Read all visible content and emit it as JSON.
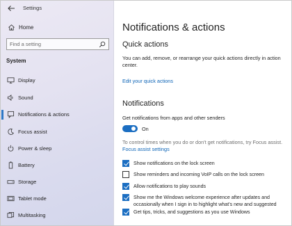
{
  "window": {
    "title": "Settings"
  },
  "sidebar": {
    "home_label": "Home",
    "search_placeholder": "Find a setting",
    "section_label": "System",
    "items": [
      {
        "label": "Display",
        "icon": "display-icon"
      },
      {
        "label": "Sound",
        "icon": "sound-icon"
      },
      {
        "label": "Notifications & actions",
        "icon": "notifications-icon",
        "active": true
      },
      {
        "label": "Focus assist",
        "icon": "moon-icon"
      },
      {
        "label": "Power & sleep",
        "icon": "power-icon"
      },
      {
        "label": "Battery",
        "icon": "battery-icon"
      },
      {
        "label": "Storage",
        "icon": "storage-icon"
      },
      {
        "label": "Tablet mode",
        "icon": "tablet-icon"
      },
      {
        "label": "Multitasking",
        "icon": "multitasking-icon"
      }
    ]
  },
  "main": {
    "title": "Notifications & actions",
    "quick_actions": {
      "heading": "Quick actions",
      "description": "You can add, remove, or rearrange your quick actions directly in action center.",
      "link": "Edit your quick actions"
    },
    "notifications": {
      "heading": "Notifications",
      "get_label": "Get notifications from apps and other senders",
      "toggle_state": "On",
      "toggle_on": true,
      "focus_text": "To control times when you do or don't get notifications, try Focus assist.",
      "focus_link": "Focus assist settings",
      "checkboxes": [
        {
          "label": "Show notifications on the lock screen",
          "checked": true
        },
        {
          "label": "Show reminders and incoming VoIP calls on the lock screen",
          "checked": false
        },
        {
          "label": "Allow notifications to play sounds",
          "checked": true
        },
        {
          "label": "Show me the Windows welcome experience after updates and occasionally when I sign in to highlight what's new and suggested",
          "checked": true
        },
        {
          "label": "Get tips, tricks, and suggestions as you use Windows",
          "checked": true
        }
      ]
    }
  },
  "colors": {
    "accent": "#1b6ec2",
    "link": "#0b63b6",
    "sidebar_bg": "#e4e2f1"
  }
}
